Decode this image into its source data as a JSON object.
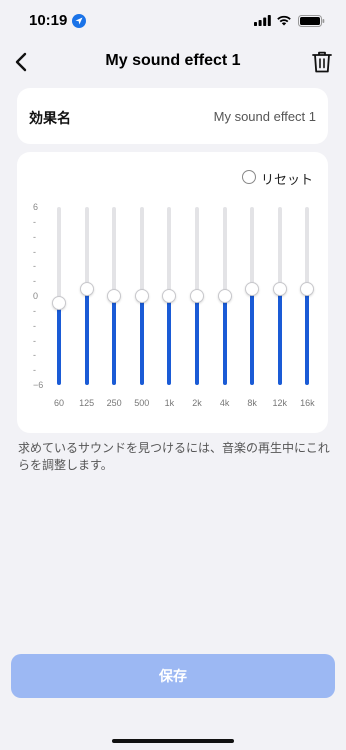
{
  "status_bar": {
    "time": "10:19"
  },
  "nav": {
    "title": "My sound effect 1"
  },
  "effect_name": {
    "label": "効果名",
    "value": "My sound effect 1"
  },
  "equalizer": {
    "reset_label": "リセット",
    "y_ticks": [
      "6",
      "-",
      "-",
      "-",
      "-",
      "-",
      "0",
      "-",
      "-",
      "-",
      "-",
      "-",
      "−6"
    ],
    "bands": [
      {
        "freq": "60",
        "level": -0.5
      },
      {
        "freq": "125",
        "level": 0.5
      },
      {
        "freq": "250",
        "level": 0
      },
      {
        "freq": "500",
        "level": 0
      },
      {
        "freq": "1k",
        "level": 0
      },
      {
        "freq": "2k",
        "level": 0
      },
      {
        "freq": "4k",
        "level": 0
      },
      {
        "freq": "8k",
        "level": 0.5
      },
      {
        "freq": "12k",
        "level": 0.5
      },
      {
        "freq": "16k",
        "level": 0.5
      }
    ]
  },
  "hint": "求めているサウンドを見つけるには、音楽の再生中にこれらを調整します。",
  "save_label": "保存",
  "colors": {
    "accent": "#1a5bd6",
    "save_button": "#9cb8f3",
    "background": "#f2f2f6"
  }
}
